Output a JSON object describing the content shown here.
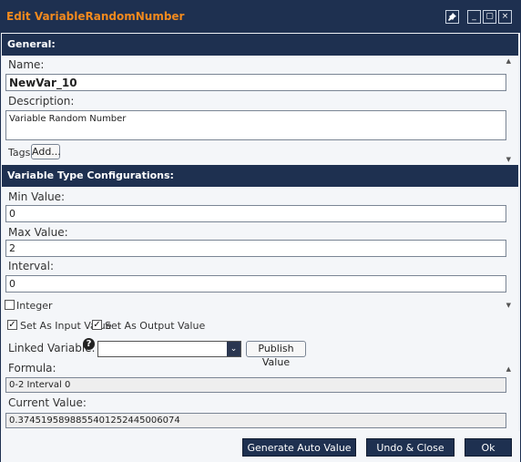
{
  "window": {
    "title": "Edit VariableRandomNumber",
    "buttons": {
      "pin": "pin-icon",
      "minimize": "_",
      "maximize": "▢",
      "close": "×"
    }
  },
  "general": {
    "header": "General:",
    "name_label": "Name:",
    "name_value": "NewVar_10",
    "description_label": "Description:",
    "description_value": "Variable Random Number",
    "tags_label": "Tags:",
    "add_button": "Add..."
  },
  "config": {
    "header": "Variable Type Configurations:",
    "min_label": "Min Value:",
    "min_value": "0",
    "max_label": "Max Value:",
    "max_value": "2",
    "interval_label": "Interval:",
    "interval_value": "0",
    "integer_label": "Integer",
    "integer_checked": false
  },
  "options": {
    "input_label": "Set As Input Value",
    "input_checked": true,
    "output_label": "Set As Output Value",
    "output_checked": true,
    "linked_label": "Linked Variable:",
    "linked_value": "",
    "publish_button": "Publish Value",
    "formula_label": "Formula:",
    "formula_value": "0-2 Interval 0",
    "current_label": "Current Value:",
    "current_value": "0.374519589885540125244500607‌4"
  },
  "footer": {
    "generate_button": "Generate Auto Value",
    "undo_button": "Undo & Close",
    "ok_button": "Ok"
  },
  "colors": {
    "titlebar": "#1e3050",
    "title_text": "#f28a1e"
  }
}
